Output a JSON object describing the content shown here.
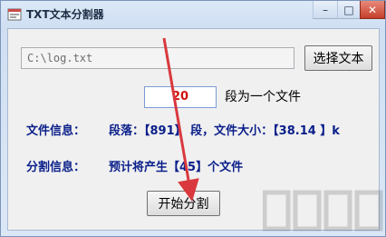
{
  "window": {
    "title": "TXT文本分割器",
    "controls": {
      "minimize": "–",
      "maximize": "□",
      "close": "✕"
    }
  },
  "file": {
    "path_value": "C:\\log.txt",
    "select_button": "选择文本"
  },
  "split": {
    "count_value": "20",
    "count_label": "段为一个文件"
  },
  "file_info": {
    "label": "文件信息：",
    "value": "段落：【891】 段，文件大小：【38.14 】k"
  },
  "split_info": {
    "label": "分割信息：",
    "value": "预计将产生【45】个文件"
  },
  "actions": {
    "start_button": "开始分割"
  },
  "colors": {
    "info_text": "#0a1f8a",
    "count_text": "#d01010",
    "arrow": "#d9393e"
  },
  "icons": [
    "app-icon",
    "minimize-icon",
    "maximize-icon",
    "close-icon",
    "annotation-arrow"
  ]
}
